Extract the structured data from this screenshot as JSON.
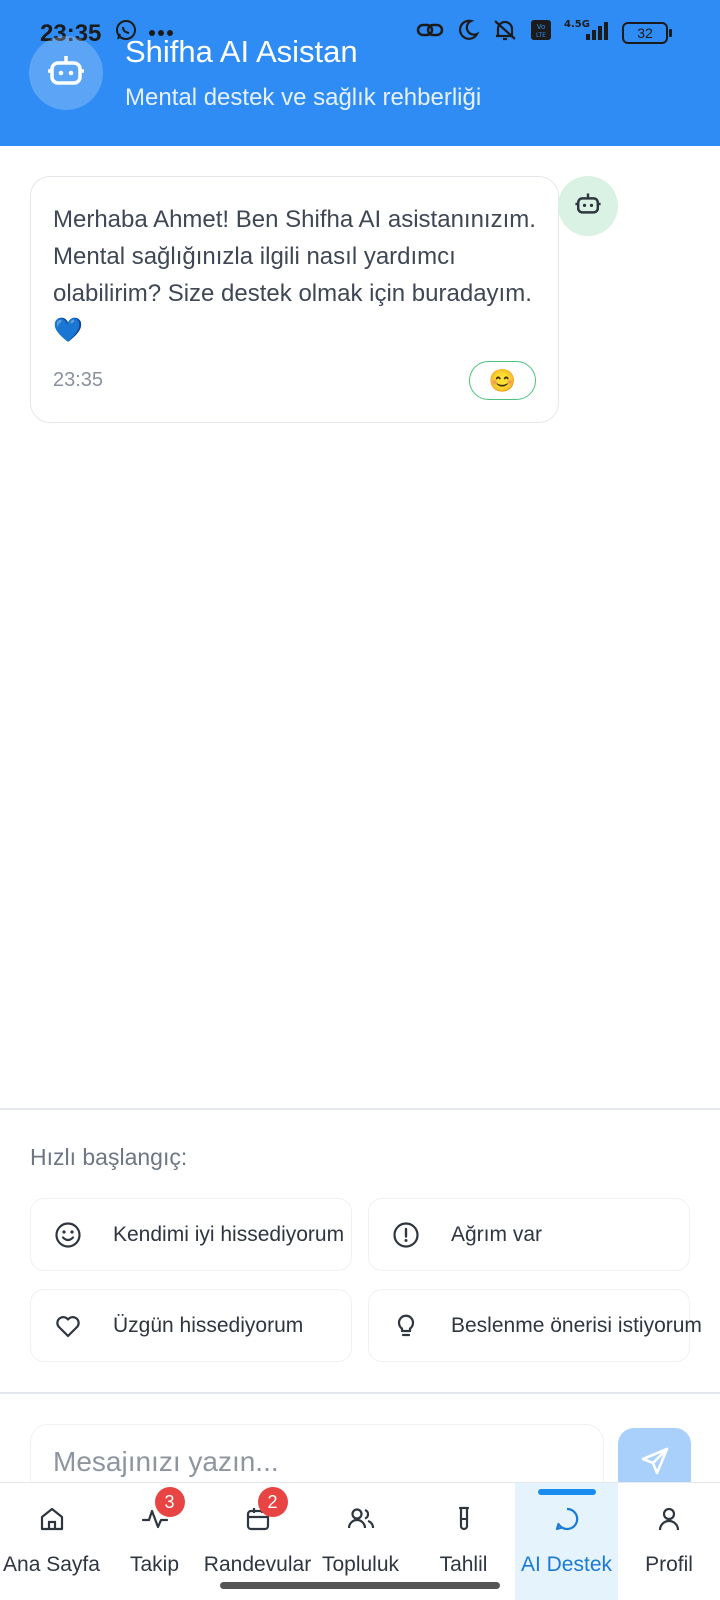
{
  "status_bar": {
    "time": "23:35",
    "battery": "32"
  },
  "header": {
    "title": "Shifha AI Asistan",
    "subtitle": "Mental destek ve sağlık rehberliği"
  },
  "chat": {
    "messages": [
      {
        "sender": "bot",
        "text": "Merhaba Ahmet! Ben Shifha AI asistanınızım. Mental sağlığınızla ilgili nasıl yardımcı olabilirim? Size destek olmak için buradayım. 💙",
        "time": "23:35",
        "reaction": "😊"
      }
    ]
  },
  "quick_start": {
    "label": "Hızlı başlangıç:",
    "options": [
      {
        "label": "Kendimi iyi hissediyorum",
        "icon": "smile-icon"
      },
      {
        "label": "Ağrım var",
        "icon": "alert-circle-icon"
      },
      {
        "label": "Üzgün hissediyorum",
        "icon": "heart-icon"
      },
      {
        "label": "Beslenme önerisi istiyorum",
        "icon": "lightbulb-icon"
      }
    ]
  },
  "input": {
    "placeholder": "Mesajınızı yazın..."
  },
  "nav": {
    "items": [
      {
        "label": "Ana Sayfa",
        "icon": "home-icon"
      },
      {
        "label": "Takip",
        "icon": "activity-icon",
        "badge": "3"
      },
      {
        "label": "Randevular",
        "icon": "calendar-icon",
        "badge": "2"
      },
      {
        "label": "Topluluk",
        "icon": "users-icon"
      },
      {
        "label": "Tahlil",
        "icon": "test-tube-icon"
      },
      {
        "label": "AI Destek",
        "icon": "message-circle-icon",
        "active": true
      },
      {
        "label": "Profil",
        "icon": "user-icon"
      }
    ]
  },
  "colors": {
    "header_bg": "#2f8cf4",
    "active_nav": "#1a7ad8",
    "badge": "#e84444",
    "reaction_border": "#4cc27b"
  }
}
